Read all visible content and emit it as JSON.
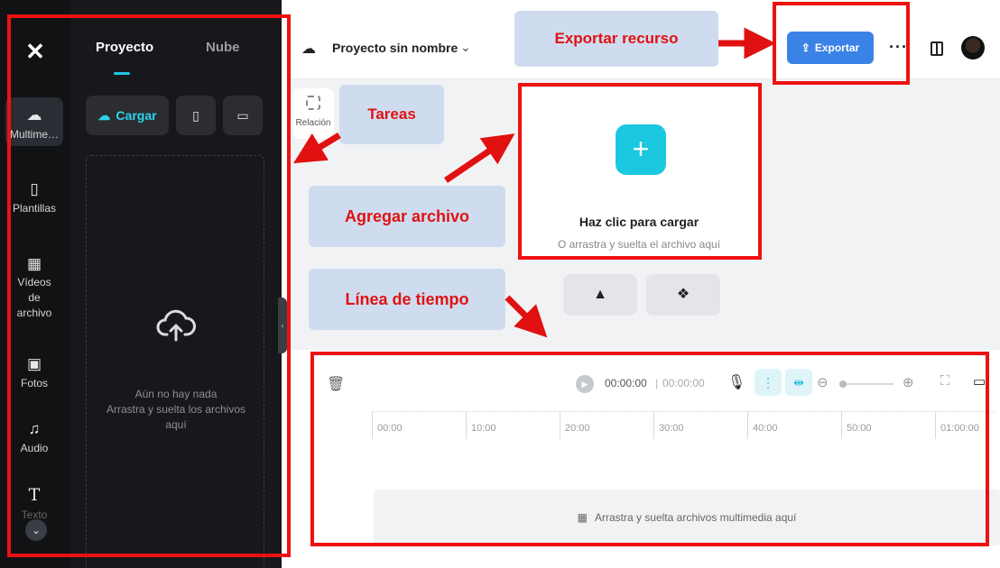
{
  "rail": {
    "items": [
      {
        "icon": "upload-cloud-icon",
        "glyph": "☁",
        "label": "Multime…"
      },
      {
        "icon": "templates-icon",
        "glyph": "▯",
        "label": "Plantillas"
      },
      {
        "icon": "film-icon",
        "glyph": "▦",
        "label": "Vídeos de archivo"
      },
      {
        "icon": "image-icon",
        "glyph": "▣",
        "label": "Fotos"
      },
      {
        "icon": "music-note-icon",
        "glyph": "♫",
        "label": "Audio"
      },
      {
        "icon": "text-icon",
        "glyph": "T",
        "label": "Texto"
      }
    ]
  },
  "panel": {
    "tabs": [
      "Proyecto",
      "Nube"
    ],
    "upload_label": "Cargar",
    "empty_title": "Aún no hay nada",
    "empty_hint": "Arrastra y suelta los archivos aquí"
  },
  "topbar": {
    "project_name": "Proyecto sin nombre",
    "export_label": "Exportar"
  },
  "canvas": {
    "relacion_label": "Relación",
    "upload_title": "Haz clic para cargar",
    "upload_sub": "O arrastra y suelta el archivo aquí"
  },
  "timeline": {
    "current_time": "00:00:00",
    "total_time": "00:00:00",
    "ruler": [
      "00:00",
      "10:00",
      "20:00",
      "30:00",
      "40:00",
      "50:00",
      "01:00:00"
    ],
    "track_hint": "Arrastra y suelta archivos multimedia aquí"
  },
  "annotations": {
    "export": "Exportar recurso",
    "tasks": "Tareas",
    "add_file": "Agregar archivo",
    "timeline": "Línea de tiempo"
  },
  "colors": {
    "accent": "#1fc8e3",
    "export_btn": "#3b82e6",
    "annotation_red": "#e11111",
    "callout_bg": "#cfdcef"
  }
}
